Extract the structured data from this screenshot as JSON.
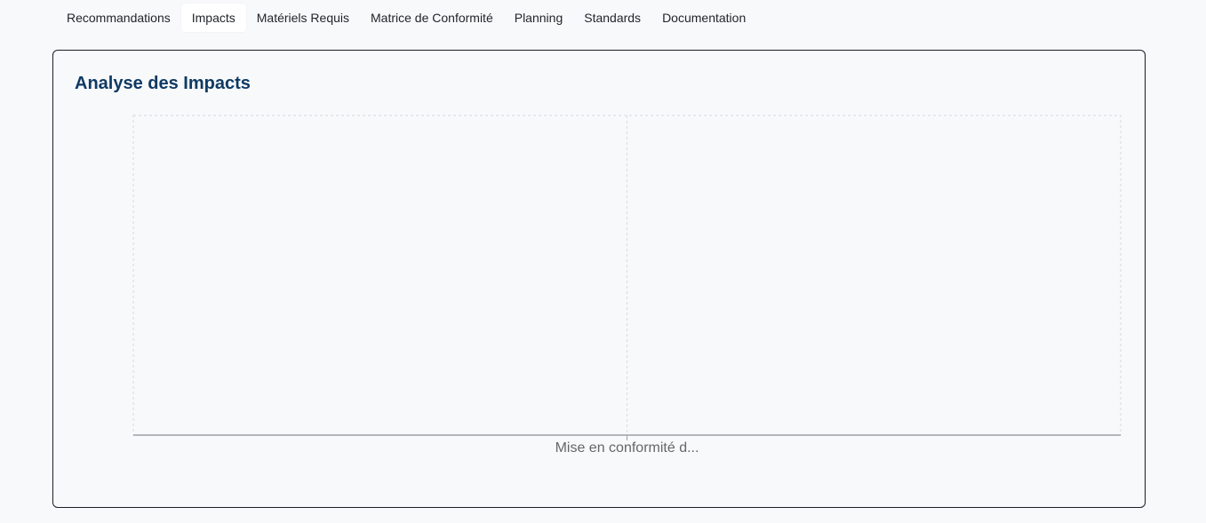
{
  "tabs": [
    {
      "label": "Recommandations",
      "active": false
    },
    {
      "label": "Impacts",
      "active": true
    },
    {
      "label": "Matériels Requis",
      "active": false
    },
    {
      "label": "Matrice de Conformité",
      "active": false
    },
    {
      "label": "Planning",
      "active": false
    },
    {
      "label": "Standards",
      "active": false
    },
    {
      "label": "Documentation",
      "active": false
    }
  ],
  "card": {
    "title": "Analyse des Impacts"
  },
  "chart_data": {
    "type": "bar",
    "categories": [
      "Mise en conformité d..."
    ],
    "series": [],
    "xlabel": "",
    "ylabel": "",
    "grid": true
  },
  "colors": {
    "title": "#0f3a63",
    "grid": "#d6d9de",
    "axis": "#9aa0a6",
    "tick_text": "#666666"
  }
}
